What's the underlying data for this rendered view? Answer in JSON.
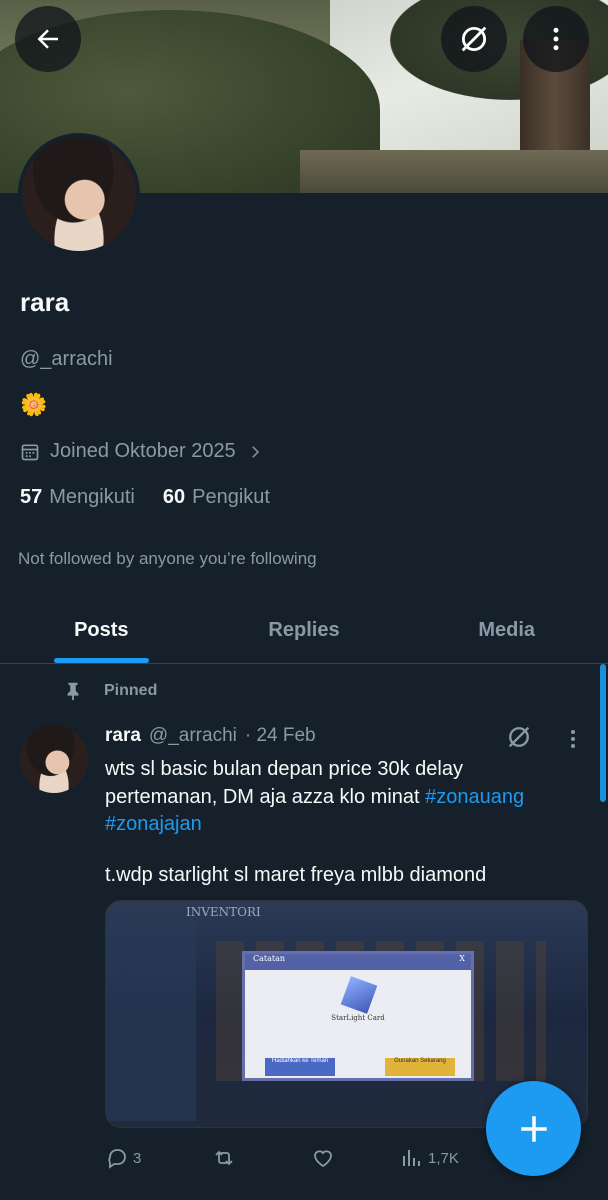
{
  "profile": {
    "name": "rara",
    "handle": "@_arrachi",
    "bio_emoji": "🌼",
    "joined": "Joined Oktober 2025",
    "following_count": "57",
    "following_label": "Mengikuti",
    "followers_count": "60",
    "followers_label": "Pengikut",
    "not_followed": "Not followed by anyone you’re following"
  },
  "tabs": [
    {
      "label": "Posts"
    },
    {
      "label": "Replies"
    },
    {
      "label": "Media"
    }
  ],
  "post": {
    "pinned_label": "Pinned",
    "name": "rara",
    "handle": "@_arrachi",
    "date": "· 24 Feb",
    "text_line": "wts sl basic bulan depan price 30k delay pertemanan, DM aja azza klo minat ",
    "hashtag1": "#zonauang",
    "hashtag2": "#zonajajan",
    "text2": "t.wdp starlight sl maret freya mlbb diamond",
    "media": {
      "header": "INVENTORI",
      "dialog_title": "Catatan",
      "dialog_close": "X",
      "card_title": "StarLight Card",
      "btn1": "Hadiahkan ke Teman",
      "btn2": "Gunakan Sekarang"
    },
    "replies": "3",
    "views": "1,7K"
  },
  "icons": {
    "back": "arrow-left-icon",
    "grok": "grok-icon",
    "more": "more-vertical-icon",
    "calendar": "calendar-icon",
    "chevron": "chevron-right-icon",
    "pin": "pin-icon",
    "reply": "reply-icon",
    "retweet": "retweet-icon",
    "like": "heart-icon",
    "views": "views-icon",
    "compose": "plus-icon"
  },
  "colors": {
    "accent": "#1d9bf0",
    "background": "#15202b",
    "muted": "#8b98a5"
  }
}
